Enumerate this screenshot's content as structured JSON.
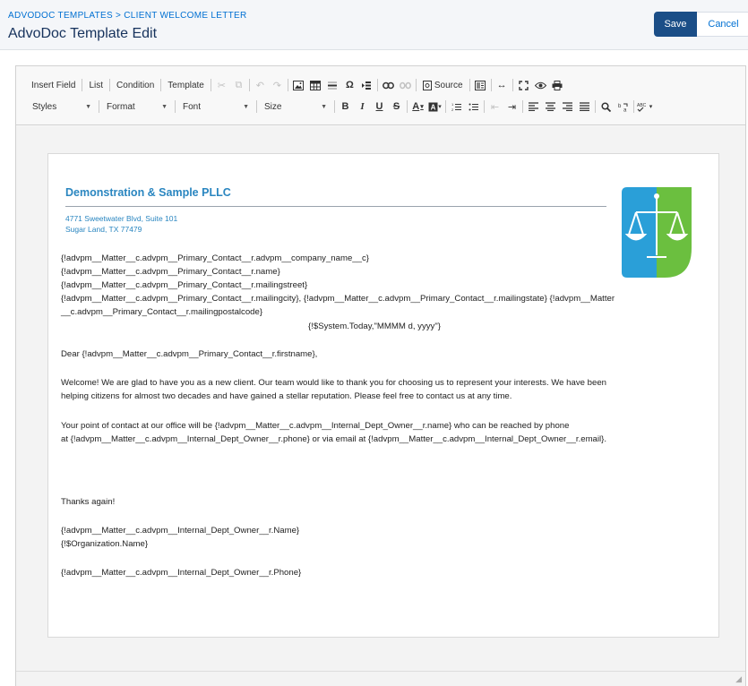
{
  "header": {
    "breadcrumb": "ADVODOC TEMPLATES > CLIENT WELCOME LETTER",
    "title": "AdvoDoc Template Edit",
    "save_label": "Save",
    "cancel_label": "Cancel"
  },
  "toolbar": {
    "insert_field": "Insert Field",
    "list": "List",
    "condition": "Condition",
    "template": "Template",
    "source": "Source",
    "styles": "Styles",
    "format": "Format",
    "font": "Font",
    "size": "Size"
  },
  "letter": {
    "firm_name": "Demonstration & Sample PLLC",
    "address_line1": "4771 Sweetwater Blvd, Suite 101",
    "address_line2": "Sugar Land, TX 77479",
    "merge_lines": [
      "{!advpm__Matter__c.advpm__Primary_Contact__r.advpm__company_name__c}",
      "{!advpm__Matter__c.advpm__Primary_Contact__r.name}",
      "{!advpm__Matter__c.advpm__Primary_Contact__r.mailingstreet}",
      "{!advpm__Matter__c.advpm__Primary_Contact__r.mailingcity}, {!advpm__Matter__c.advpm__Primary_Contact__r.mailingstate} {!advpm__Matter",
      "__c.advpm__Primary_Contact__r.mailingpostalcode}"
    ],
    "date_field": "{!$System.Today,\"MMMM d, yyyy\"}",
    "salutation": "Dear {!advpm__Matter__c.advpm__Primary_Contact__r.firstname},",
    "para1_line1": "Welcome! We are glad to have you as a new client. Our team would like to thank you for choosing us to represent your interests. We have been",
    "para1_line2": "helping citizens for almost two decades and have gained a stellar reputation. Please feel free to contact us at any time.",
    "para2_line1": "Your point of contact at our office will be {!advpm__Matter__c.advpm__Internal_Dept_Owner__r.name} who can be reached by phone",
    "para2_line2": "at {!advpm__Matter__c.advpm__Internal_Dept_Owner__r.phone} or via email at {!advpm__Matter__c.advpm__Internal_Dept_Owner__r.email}.",
    "closing": "Thanks again!",
    "signature1": "{!advpm__Matter__c.advpm__Internal_Dept_Owner__r.Name}",
    "signature2": "{!$Organization.Name}",
    "signature3": "{!advpm__Matter__c.advpm__Internal_Dept_Owner__r.Phone}"
  },
  "colors": {
    "brand_blue": "#2a86c0",
    "logo_green": "#6bbf3f",
    "save_button": "#1b4e87"
  }
}
